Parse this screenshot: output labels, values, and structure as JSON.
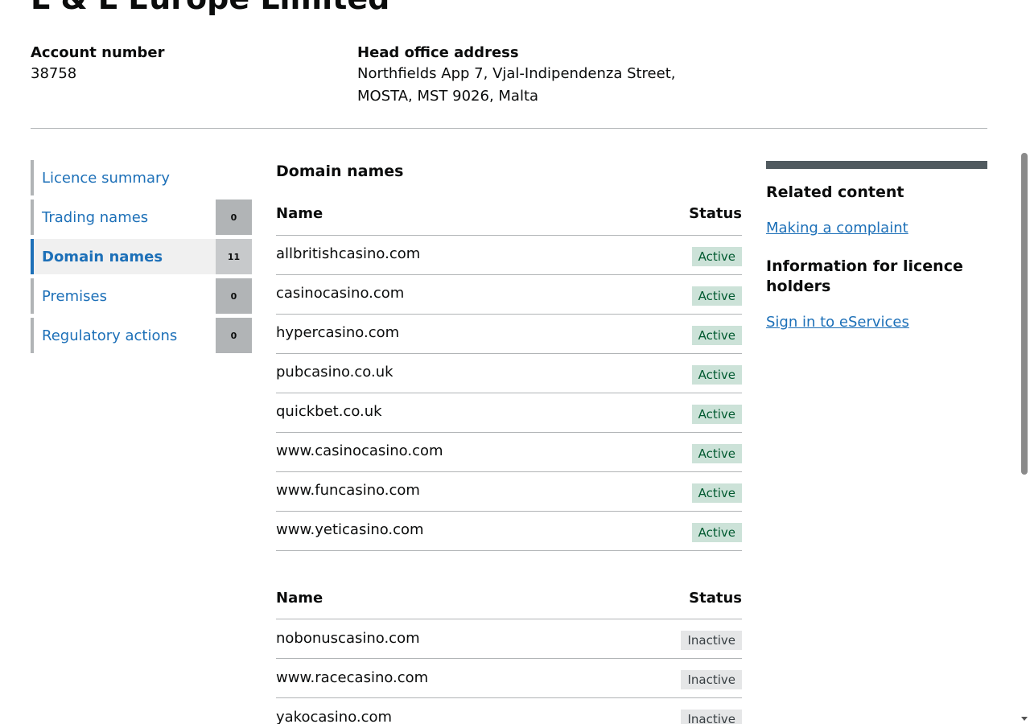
{
  "header": {
    "title": "L & L Europe Limited"
  },
  "account": {
    "label": "Account number",
    "value": "38758"
  },
  "address": {
    "label": "Head office address",
    "line1": "Northfields App 7, Vjal-Indipendenza Street,",
    "line2": "MOSTA, MST 9026, Malta"
  },
  "sidebar": {
    "items": [
      {
        "label": "Licence summary",
        "count": ""
      },
      {
        "label": "Trading names",
        "count": "0"
      },
      {
        "label": "Domain names",
        "count": "11"
      },
      {
        "label": "Premises",
        "count": "0"
      },
      {
        "label": "Regulatory actions",
        "count": "0"
      }
    ]
  },
  "main": {
    "heading": "Domain names",
    "active_table": {
      "headers": {
        "name": "Name",
        "status": "Status"
      },
      "rows": [
        {
          "name": "allbritishcasino.com",
          "status": "Active"
        },
        {
          "name": "casinocasino.com",
          "status": "Active"
        },
        {
          "name": "hypercasino.com",
          "status": "Active"
        },
        {
          "name": "pubcasino.co.uk",
          "status": "Active"
        },
        {
          "name": "quickbet.co.uk",
          "status": "Active"
        },
        {
          "name": "www.casinocasino.com",
          "status": "Active"
        },
        {
          "name": "www.funcasino.com",
          "status": "Active"
        },
        {
          "name": "www.yeticasino.com",
          "status": "Active"
        }
      ]
    },
    "inactive_table": {
      "headers": {
        "name": "Name",
        "status": "Status"
      },
      "rows": [
        {
          "name": "nobonuscasino.com",
          "status": "Inactive"
        },
        {
          "name": "www.racecasino.com",
          "status": "Inactive"
        },
        {
          "name": "yakocasino.com",
          "status": "Inactive"
        }
      ]
    }
  },
  "related": {
    "heading": "Related content",
    "link1": "Making a complaint",
    "heading2": "Information for licence holders",
    "link2": "Sign in to eServices"
  },
  "colors": {
    "link": "#1d70b8",
    "active_tag_bg": "#cce2d8",
    "active_tag_text": "#005a30",
    "inactive_tag_bg": "#e5e6e7",
    "inactive_tag_text": "#383f43"
  }
}
